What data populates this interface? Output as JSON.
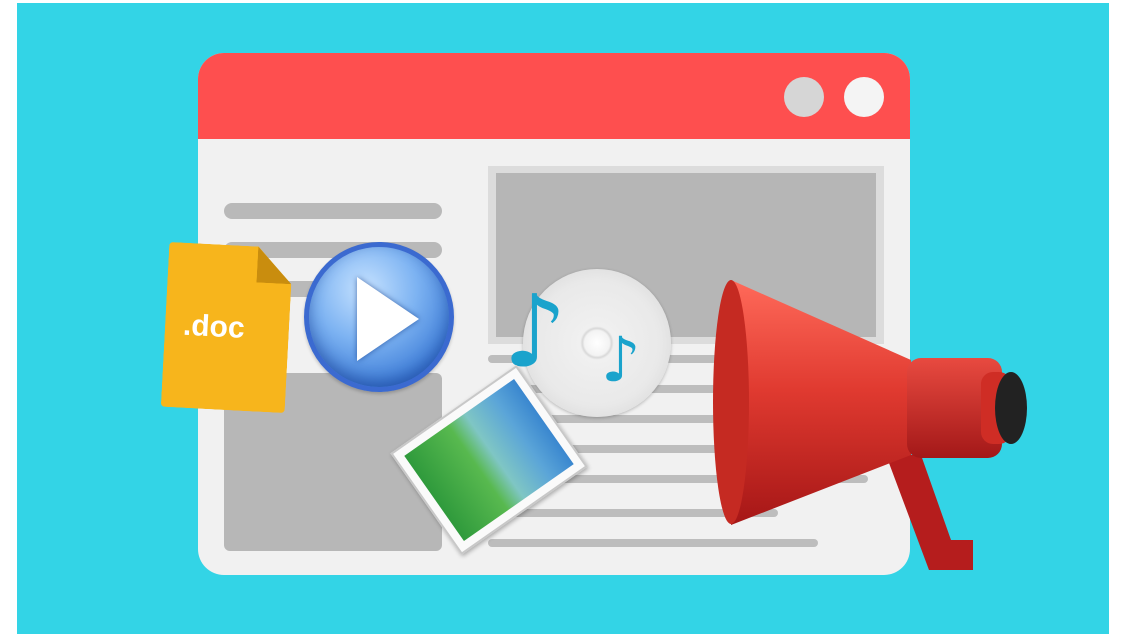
{
  "doc_icon": {
    "label": ".doc"
  },
  "colors": {
    "background": "#33d4e6",
    "titlebar": "#fe4f4f",
    "content_gray": "#b7b7b7",
    "doc_yellow": "#f7b51c",
    "play_blue": "#3f7ed8",
    "note_blue": "#1aa3cc",
    "megaphone_red": "#d32a2a"
  },
  "icons": [
    "doc-file-icon",
    "play-icon",
    "music-disc-icon",
    "image-file-icon",
    "megaphone-icon"
  ]
}
